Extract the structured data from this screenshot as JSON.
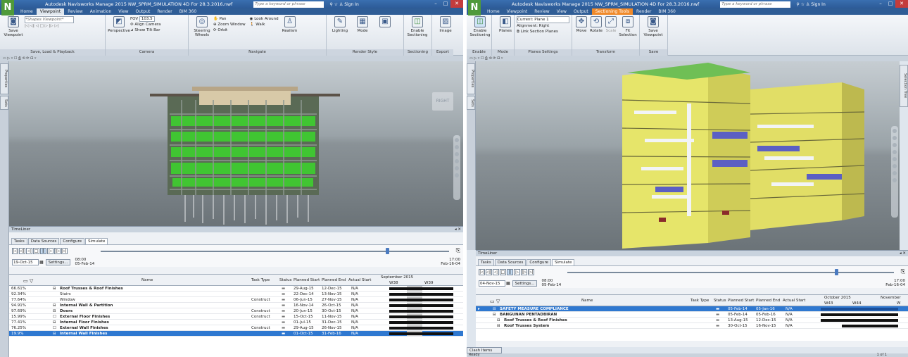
{
  "left": {
    "title": "Autodesk Navisworks Manage 2015   NW_SPRM_SIMULATION 4D For 28.3.2016.nwf",
    "search_placeholder": "Type a keyword or phrase",
    "sign_in": "Sign In",
    "tabs": [
      "Home",
      "Viewpoint",
      "Review",
      "Animation",
      "View",
      "Output",
      "Render",
      "BIM 360"
    ],
    "active_tab": "Viewpoint",
    "ribbon": {
      "save_viewpoint": "Save Viewpoint",
      "current_viewpoint": "*Shapes Viewpoint*",
      "perspective": "Perspective",
      "fov": "103.5",
      "align_camera": "Align Camera",
      "show_tilt_bar": "Show Tilt Bar",
      "steering_wheels": "Steering Wheels",
      "pan": "Pan",
      "zoom_window": "Zoom Window",
      "orbit": "Orbit",
      "look_around": "Look Around",
      "walk": "Walk",
      "realism": "Realism",
      "lighting": "Lighting",
      "mode": "Mode",
      "enable_sectioning": "Enable Sectioning",
      "image": "Image",
      "groups": [
        "Save, Load & Playback",
        "Camera",
        "Navigate",
        "Render Style",
        "Sectioning",
        "Export"
      ]
    },
    "viewcube": "RIGHT",
    "sidetabs": [
      "Properties",
      "Sets"
    ],
    "timeliner": {
      "header": "TimeLiner",
      "tabs": [
        "Tasks",
        "Data Sources",
        "Configure",
        "Simulate"
      ],
      "date": "19-Oct-15",
      "settings": "Settings...",
      "time_left": "08:00",
      "date_left": "05-Feb-14",
      "time_right": "17:00",
      "date_right": "Feb-16-04",
      "columns": [
        "Name",
        "Task Type",
        "Status",
        "Planned Start",
        "Planned End",
        "Actual Start"
      ],
      "gantt_month": "September 2015",
      "gantt_weeks": [
        "W38",
        "W39"
      ],
      "rows": [
        {
          "pct": "66.61%",
          "name": "Roof Trusses & Roof Finishes",
          "type": "",
          "start": "29-Aug-15",
          "end": "12-Dec-15",
          "actual": "N/A",
          "bold": true,
          "exp": "⊟"
        },
        {
          "pct": "92.34%",
          "name": "Stairs",
          "type": "",
          "start": "22-Dec-14",
          "end": "13-Nov-15",
          "actual": "N/A",
          "bold": false,
          "exp": ""
        },
        {
          "pct": "77.64%",
          "name": "Window",
          "type": "Construct",
          "start": "06-Jun-15",
          "end": "27-Nov-15",
          "actual": "N/A",
          "bold": false,
          "exp": ""
        },
        {
          "pct": "94.91%",
          "name": "Internal Wall & Partition",
          "type": "",
          "start": "16-Nov-14",
          "end": "26-Oct-15",
          "actual": "N/A",
          "bold": true,
          "exp": "⊟"
        },
        {
          "pct": "97.69%",
          "name": "Doors",
          "type": "Construct",
          "start": "20-Jun-15",
          "end": "30-Oct-15",
          "actual": "N/A",
          "bold": true,
          "exp": "⊟"
        },
        {
          "pct": "15.99%",
          "name": "External Floor Finishes",
          "type": "Construct",
          "start": "15-Oct-15",
          "end": "11-Nov-15",
          "actual": "N/A",
          "bold": true,
          "exp": "☐"
        },
        {
          "pct": "77.41%",
          "name": "Internal Floor Finishes",
          "type": "",
          "start": "01-Jul-15",
          "end": "31-Dec-15",
          "actual": "N/A",
          "bold": true,
          "exp": "⊟"
        },
        {
          "pct": "76.25%",
          "name": "External Wall Finishes",
          "type": "Construct",
          "start": "29-Aug-15",
          "end": "26-Nov-15",
          "actual": "N/A",
          "bold": true,
          "exp": "☐"
        },
        {
          "pct": "19.9%",
          "name": "Internal Wall Finishes",
          "type": "",
          "start": "01-Oct-15",
          "end": "31-Feb-16",
          "actual": "N/A",
          "bold": true,
          "exp": "⊟"
        }
      ]
    }
  },
  "right": {
    "title": "Autodesk Navisworks Manage 2015   NW_SPRM_SIMULATION 4D For 28.3.2016.nwf",
    "search_placeholder": "Type a keyword or phrase",
    "sign_in": "Sign In",
    "tabs": [
      "Home",
      "Viewpoint",
      "Review",
      "View",
      "Output",
      "Sectioning Tools",
      "Render",
      "BIM 360"
    ],
    "active_tab": "Sectioning Tools",
    "ribbon": {
      "enable_sectioning": "Enable Sectioning",
      "planes": "Planes",
      "current_plane": "Current: Plane 1",
      "alignment": "Alignment: Right",
      "link_planes": "Link Section Planes",
      "move": "Move",
      "rotate": "Rotate",
      "scale": "Scale",
      "fit_selection": "Fit Selection",
      "save_viewpoint": "Save Viewpoint",
      "groups": [
        "Enable",
        "Mode",
        "Planes Settings",
        "Transform",
        "Save"
      ]
    },
    "sidetabs": [
      "Properties",
      "Sets"
    ],
    "right_sidetab": "Selection Tree",
    "timeliner": {
      "header": "TimeLiner",
      "tabs": [
        "Tasks",
        "Data Sources",
        "Configure",
        "Simulate"
      ],
      "date": "04-Nov-15",
      "settings": "Settings...",
      "time_left": "08:00",
      "date_left": "05-Feb-14",
      "time_right": "17:00",
      "date_right": "Feb-16-04",
      "columns": [
        "Name",
        "Task Type",
        "Status",
        "Planned Start",
        "Planned End",
        "Actual Start"
      ],
      "gantt_month": "October 2015",
      "gantt_month2": "November",
      "gantt_weeks": [
        "W43",
        "W44",
        "W"
      ],
      "rows": [
        {
          "name": "SAFETY MEASURE COMPLIANCE",
          "type": "",
          "start": "05-Feb-14",
          "end": "05-Jan-16",
          "actual": "N/A",
          "sel": true
        },
        {
          "name": "BANGUNAN PENTADBIRAN",
          "type": "",
          "start": "05-Feb-14",
          "end": "05-Feb-16",
          "actual": "N/A",
          "sel": false
        },
        {
          "name": "Roof Trusses & Roof Finishes",
          "type": "",
          "start": "13-Aug-15",
          "end": "12-Dec-15",
          "actual": "N/A",
          "sel": false
        },
        {
          "name": "Roof Trusses System",
          "type": "",
          "start": "30-Oct-15",
          "end": "16-Nov-15",
          "actual": "N/A",
          "sel": false
        }
      ],
      "page": "1 of 1"
    },
    "bottom_tab": "Clash Items",
    "status": "Ready"
  },
  "colors": {
    "accent": "#2f78d0",
    "contextual_tab": "#f08a2a",
    "titlebar": "#2c5a96"
  }
}
